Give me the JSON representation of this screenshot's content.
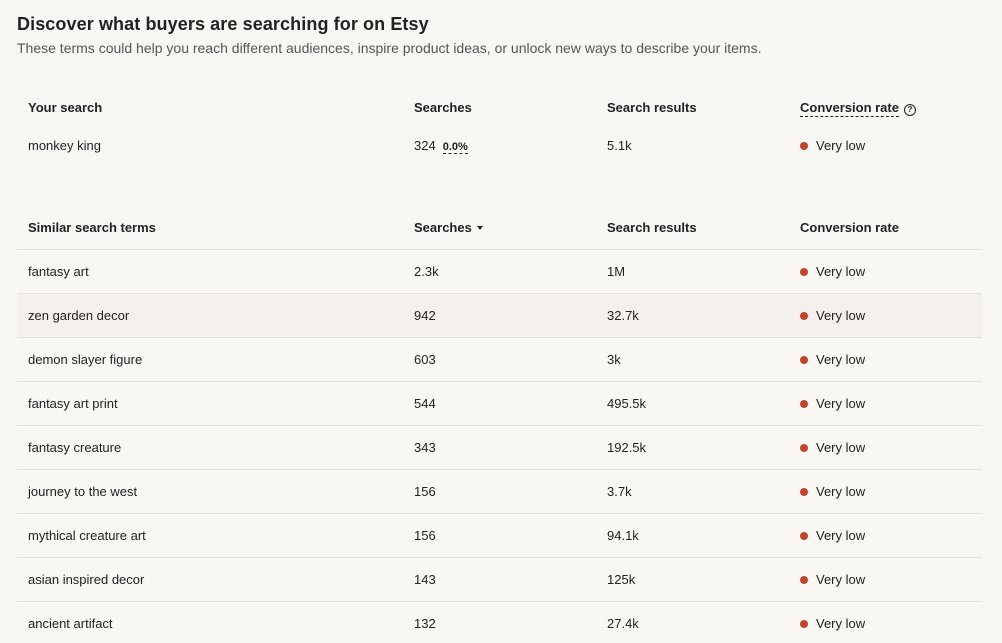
{
  "header": {
    "title": "Discover what buyers are searching for on Etsy",
    "subtitle": "These terms could help you reach different audiences, inspire product ideas, or unlock new ways to describe your items."
  },
  "your_search": {
    "headers": {
      "term": "Your search",
      "searches": "Searches",
      "results": "Search results",
      "conversion": "Conversion rate"
    },
    "row": {
      "term": "monkey king",
      "searches": "324",
      "change": "0.0%",
      "results": "5.1k",
      "conversion": "Very low"
    }
  },
  "similar": {
    "headers": {
      "term": "Similar search terms",
      "searches": "Searches",
      "results": "Search results",
      "conversion": "Conversion rate"
    },
    "rows": [
      {
        "term": "fantasy art",
        "searches": "2.3k",
        "results": "1M",
        "conversion": "Very low"
      },
      {
        "term": "zen garden decor",
        "searches": "942",
        "results": "32.7k",
        "conversion": "Very low"
      },
      {
        "term": "demon slayer figure",
        "searches": "603",
        "results": "3k",
        "conversion": "Very low"
      },
      {
        "term": "fantasy art print",
        "searches": "544",
        "results": "495.5k",
        "conversion": "Very low"
      },
      {
        "term": "fantasy creature",
        "searches": "343",
        "results": "192.5k",
        "conversion": "Very low"
      },
      {
        "term": "journey to the west",
        "searches": "156",
        "results": "3.7k",
        "conversion": "Very low"
      },
      {
        "term": "mythical creature art",
        "searches": "156",
        "results": "94.1k",
        "conversion": "Very low"
      },
      {
        "term": "asian inspired decor",
        "searches": "143",
        "results": "125k",
        "conversion": "Very low"
      },
      {
        "term": "ancient artifact",
        "searches": "132",
        "results": "27.4k",
        "conversion": "Very low"
      }
    ]
  },
  "colors": {
    "background": "#f8f7f4",
    "conversion_dot": "#c6432a",
    "highlight_row": "#f4f0ec"
  }
}
